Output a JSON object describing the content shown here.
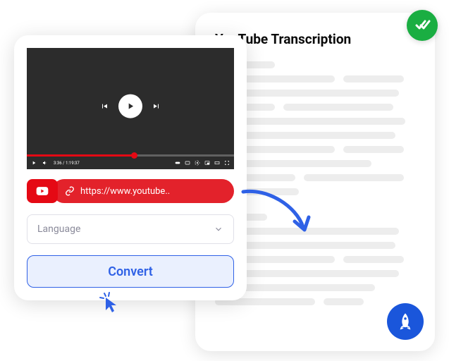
{
  "transcription": {
    "title": "YouTube Transcription"
  },
  "video": {
    "timestamp": "3:36 / 1:19:37"
  },
  "url": {
    "value": "https://www.youtube.."
  },
  "language": {
    "placeholder": "Language"
  },
  "convert": {
    "label": "Convert"
  }
}
